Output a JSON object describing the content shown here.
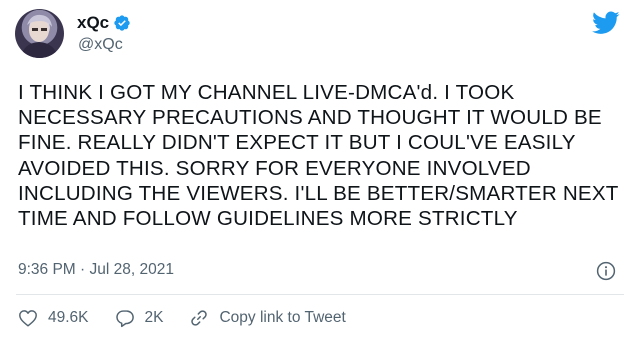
{
  "author": {
    "display_name": "xQc",
    "handle": "@xQc",
    "verified": true
  },
  "icons": {
    "brand": "twitter-bird-icon",
    "verified": "verified-badge-icon",
    "info": "info-icon",
    "like": "heart-icon",
    "reply": "reply-bubble-icon",
    "copy": "link-icon"
  },
  "colors": {
    "brand_blue": "#1d9bf0",
    "text": "#0f1419",
    "secondary_text": "#536471"
  },
  "tweet": {
    "lines": [
      "I THINK I GOT MY CHANNEL LIVE-DMCA'd. I TOOK",
      "NECESSARY PRECAUTIONS AND THOUGHT IT WOULD BE",
      "FINE. REALLY DIDN'T EXPECT IT BUT I COUL'VE EASILY",
      "AVOIDED THIS. SORRY FOR EVERYONE INVOLVED",
      "INCLUDING THE VIEWERS. I'LL BE BETTER/SMARTER NEXT",
      "TIME AND FOLLOW GUIDELINES MORE STRICTLY"
    ],
    "timestamp": "9:36 PM · Jul 28, 2021"
  },
  "actions": {
    "likes": "49.6K",
    "replies": "2K",
    "copy_link": "Copy link to Tweet"
  }
}
